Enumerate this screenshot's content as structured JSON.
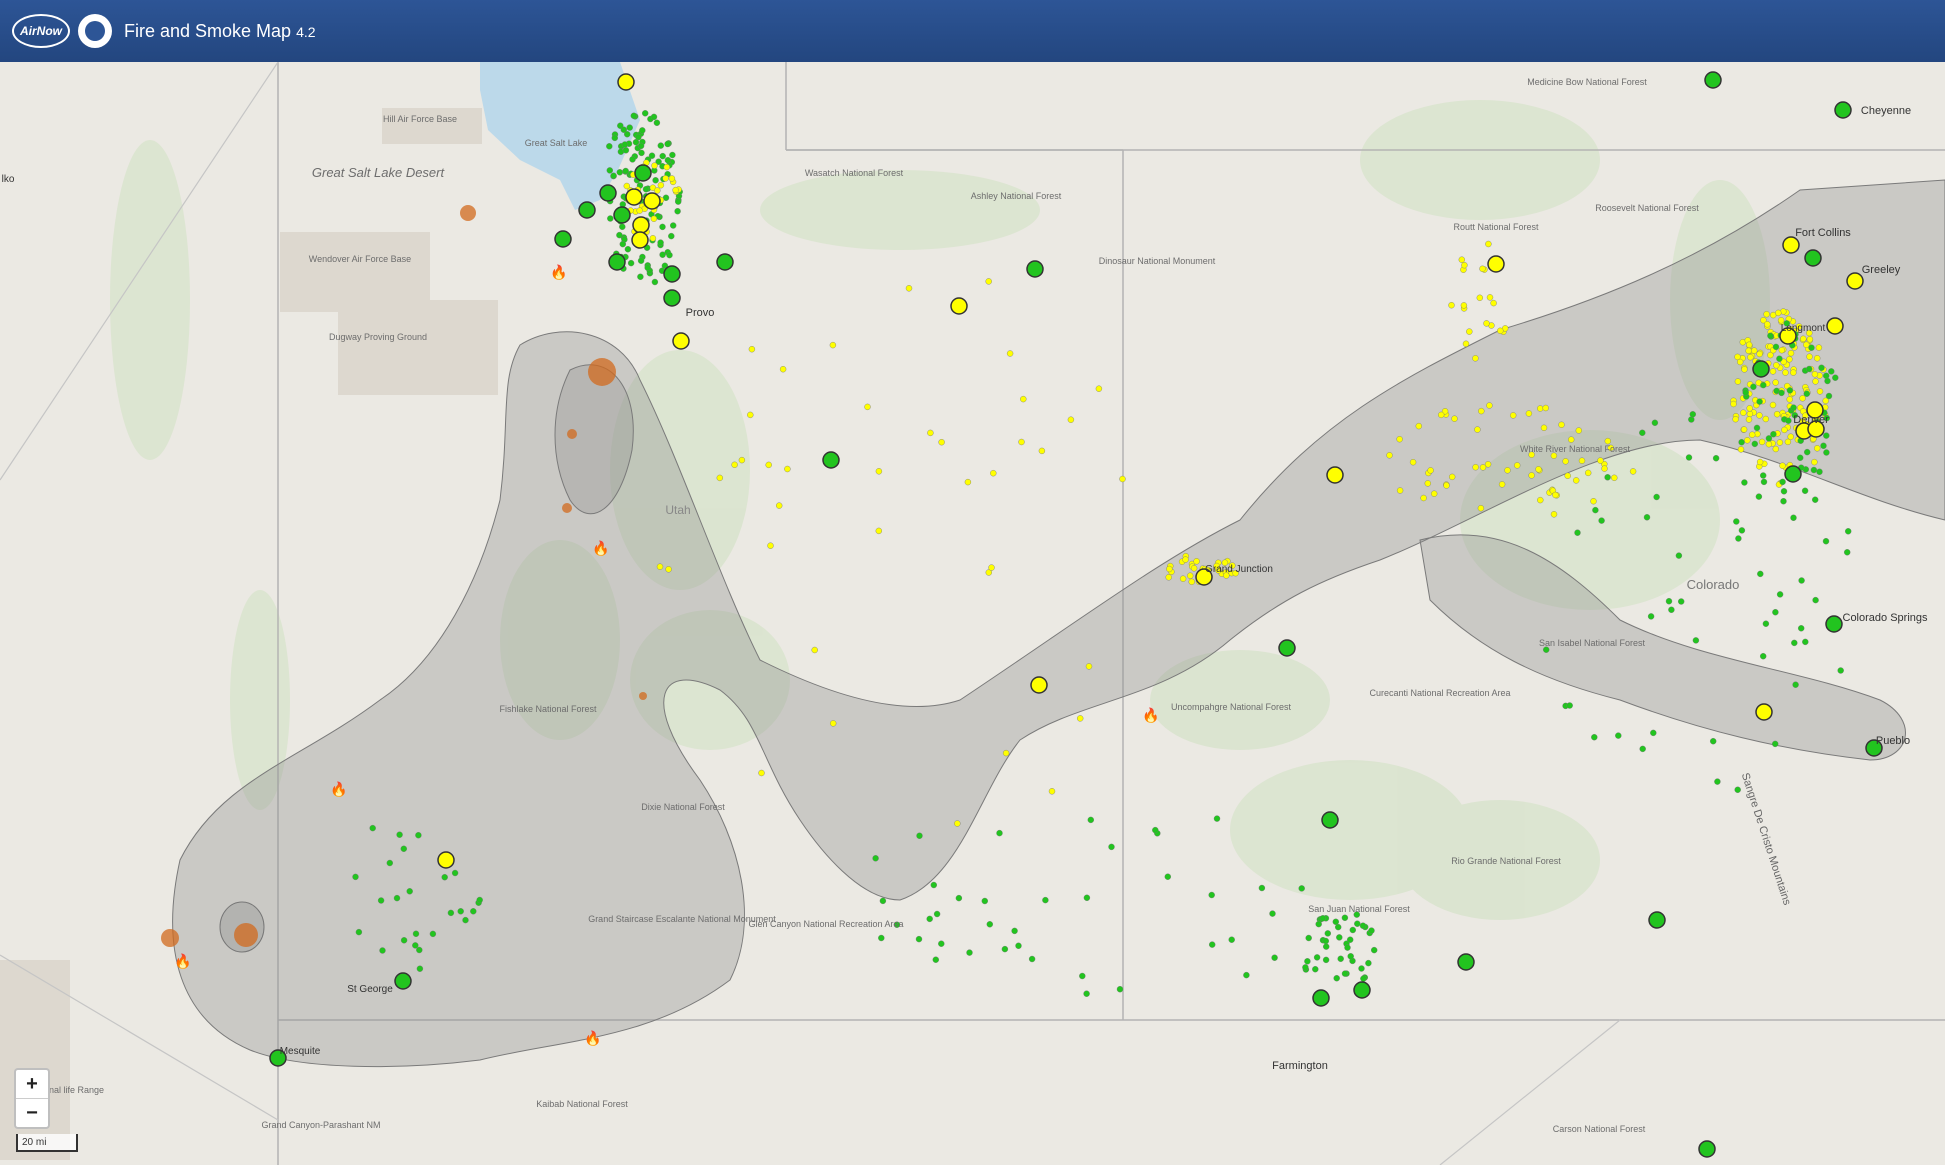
{
  "header": {
    "airnow_logo": "AirNow",
    "title": "Fire and Smoke Map",
    "version": "4.2"
  },
  "map": {
    "labels": {
      "hill_afb": "Hill Air Force Base",
      "great_salt_lake": "Great Salt Lake",
      "great_salt_lake_desert": "Great Salt Lake Desert",
      "wendover": "Wendover Air Force Base",
      "dugway": "Dugway Proving Ground",
      "elko": "lko",
      "wasatch": "Wasatch National Forest",
      "ashley": "Ashley National Forest",
      "dinosaur": "Dinosaur National Monument",
      "provo": "Provo",
      "utah": "Utah",
      "fishlake": "Fishlake National Forest",
      "dixie": "Dixie National Forest",
      "grand_staircase": "Grand Staircase Escalante National Monument",
      "glen_canyon": "Glen Canyon National Recreation Area",
      "st_george": "St George",
      "mesquite": "Mesquite",
      "kaibab": "Kaibab National Forest",
      "grand_canyon": "Grand Canyon-Parashant NM",
      "desert_range": "rt National life Range",
      "medicine_bow": "Medicine Bow National Forest",
      "cheyenne": "Cheyenne",
      "routt": "Routt National Forest",
      "roosevelt": "Roosevelt National Forest",
      "fort_collins": "Fort Collins",
      "greeley": "Greeley",
      "longmont": "Longmont",
      "denver": "Denver",
      "white_river": "White River National Forest",
      "colorado": "Colorado",
      "colorado_springs": "Colorado Springs",
      "grand_junction": "Grand Junction",
      "uncompahgre": "Uncompahgre National Forest",
      "curecanti": "Curecanti National Recreation Area",
      "san_isabel": "San Isabel National Forest",
      "pueblo": "Pueblo",
      "sangre": "Sangre De Cristo Mountains",
      "rio_grande": "Rio Grande National Forest",
      "san_juan": "San Juan National Forest",
      "farmington": "Farmington",
      "carson": "Carson National Forest"
    },
    "zoom_in_label": "+",
    "zoom_out_label": "−",
    "scale_label": "20 mi",
    "colors": {
      "good": "#22c41f",
      "moderate": "#ffff00",
      "smoke": "#8a8a8a",
      "fire": "#d2691e",
      "header": "#2d5596"
    },
    "icons": [
      "fire-icon",
      "zoom-in-icon",
      "zoom-out-icon"
    ]
  }
}
